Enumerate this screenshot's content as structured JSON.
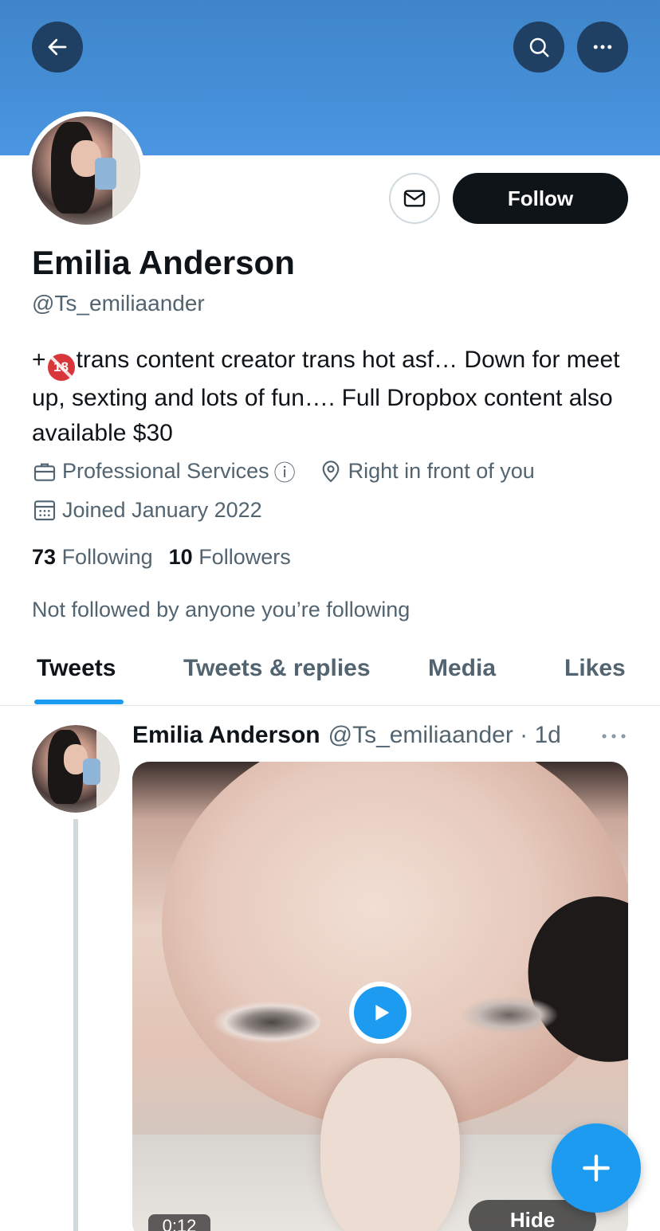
{
  "header": {
    "back_icon": "arrow-left-icon",
    "search_icon": "search-icon",
    "more_icon": "more-horizontal-icon",
    "banner_color": "#4a96e2"
  },
  "profile": {
    "name": "Emilia Anderson",
    "handle": "@Ts_emiliaander",
    "follow_label": "Follow",
    "bio_prefix": "+",
    "bio_badge": "18",
    "bio_text": "trans content creator trans hot asf… Down for meet up, sexting and lots of fun…. Full Dropbox content also available $30",
    "category": "Professional Services",
    "category_info": "ⓘ",
    "location": "Right in front of you",
    "joined": "Joined January 2022",
    "following_count": "73",
    "following_label": "Following",
    "followers_count": "10",
    "followers_label": "Followers",
    "not_followed": "Not followed by anyone you’re following"
  },
  "tabs": [
    {
      "label": "Tweets",
      "active": true
    },
    {
      "label": "Tweets & replies",
      "active": false
    },
    {
      "label": "Media",
      "active": false
    },
    {
      "label": "Likes",
      "active": false
    }
  ],
  "tweet": {
    "name": "Emilia Anderson",
    "meta": "@Ts_emiliaander · 1d",
    "duration": "0:12",
    "hide_label": "Hide"
  },
  "colors": {
    "accent": "#1d9bf0",
    "text": "#0f1419",
    "muted": "#536471"
  }
}
